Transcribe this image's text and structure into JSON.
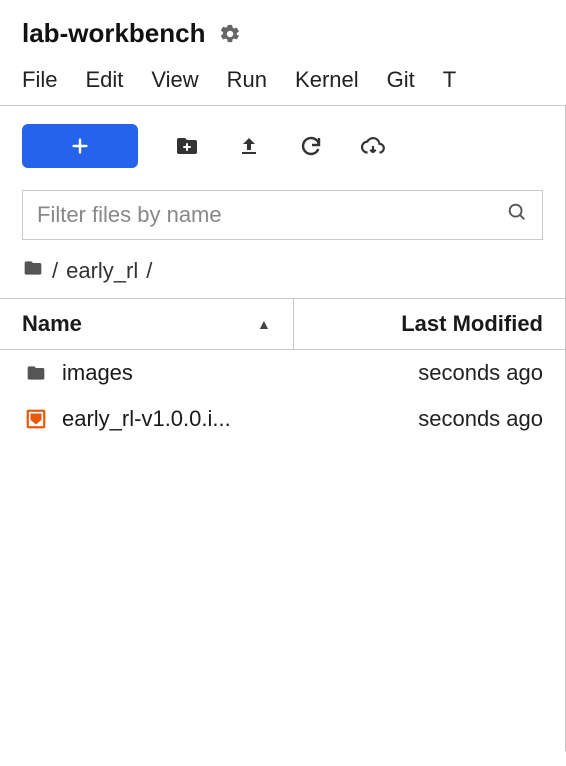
{
  "header": {
    "title": "lab-workbench"
  },
  "menubar": {
    "items": [
      "File",
      "Edit",
      "View",
      "Run",
      "Kernel",
      "Git",
      "T"
    ]
  },
  "toolbar": {
    "new_label": "+"
  },
  "filter": {
    "placeholder": "Filter files by name",
    "value": ""
  },
  "breadcrumb": {
    "parts": [
      "/",
      "early_rl",
      "/"
    ]
  },
  "columns": {
    "name": "Name",
    "modified": "Last Modified"
  },
  "files": [
    {
      "icon": "folder",
      "name": "images",
      "modified": "seconds ago"
    },
    {
      "icon": "notebook",
      "name": "early_rl-v1.0.0.i...",
      "modified": "seconds ago"
    }
  ]
}
